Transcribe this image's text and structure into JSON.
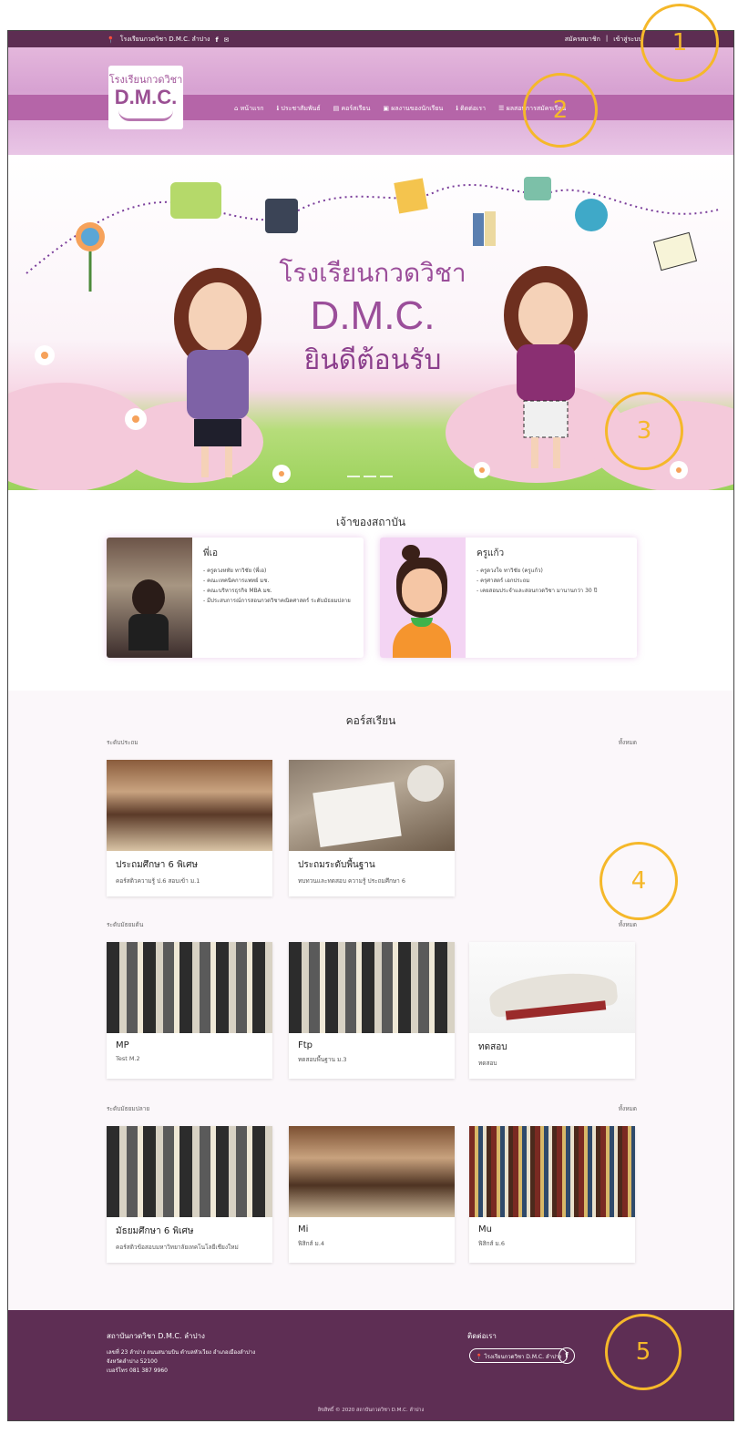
{
  "topbar": {
    "location": "โรงเรียนกวดวิชา D.M.C. ลำปาง",
    "register": "สมัครสมาชิก",
    "separator": "|",
    "login": "เข้าสู่ระบบ"
  },
  "logo": {
    "line1": "โรงเรียนกวดวิชา",
    "line2": "D.M.C."
  },
  "nav": {
    "items": [
      "หน้าแรก",
      "ประชาสัมพันธ์",
      "คอร์สเรียน",
      "ผลงานของนักเรียน",
      "ติดต่อเรา",
      "ผลสอบการสมัครเรียน"
    ]
  },
  "hero": {
    "line1": "โรงเรียนกวดวิชา",
    "line2": "D.M.C.",
    "line3": "ยินดีต้อนรับ"
  },
  "owners": {
    "title": "เจ้าของสถาบัน",
    "cards": [
      {
        "name": "พี่เอ",
        "points": [
          "- ครูดวงหทัย ทาวิชัย (พี่เอ)",
          "- คณะเทคนิคการแพทย์ มช.",
          "- คณะบริหารธุรกิจ MBA มช.",
          "- มีประสบการณ์การสอนกวดวิชาคณิตศาสตร์ ระดับมัธยมปลาย"
        ]
      },
      {
        "name": "ครูแก้ว",
        "points": [
          "- ครูดวงใจ ทาวิชัย (ครูแก้ว)",
          "- ครุศาสตร์ เอกประถม",
          "- เคยสอนประจำและสอนกวดวิชา มานานกว่า 30 ปี"
        ]
      }
    ]
  },
  "courses": {
    "title": "คอร์สเรียน",
    "see_all": "ทั้งหมด",
    "levels": [
      {
        "name": "ระดับประถม",
        "items": [
          {
            "title": "ประถมศึกษา 6 พิเศษ",
            "desc": "คอร์สติวความรู้ ป.6 สอบเข้า ม.1"
          },
          {
            "title": "ประถมระดับพื้นฐาน",
            "desc": "ทบทวนและทดสอบ ความรู้ ประถมศึกษา 6"
          }
        ]
      },
      {
        "name": "ระดับมัธยมต้น",
        "items": [
          {
            "title": "MP",
            "desc": "Test M.2"
          },
          {
            "title": "Ftp",
            "desc": "ทดสอบพื้นฐาน ม.3"
          },
          {
            "title": "ทดสอบ",
            "desc": "ทดสอบ"
          }
        ]
      },
      {
        "name": "ระดับมัธยมปลาย",
        "items": [
          {
            "title": "มัธยมศึกษา 6 พิเศษ",
            "desc": "คอร์สติวข้อสอบมหาวิทยาลัยเทคโนโลยีเชียงใหม่"
          },
          {
            "title": "Mi",
            "desc": "ฟิสิกส์ ม.4"
          },
          {
            "title": "Mu",
            "desc": "ฟิสิกส์ ม.6"
          }
        ]
      }
    ]
  },
  "footer": {
    "org": "สถาบันกวดวิชา D.M.C. ลำปาง",
    "address1": "เลขที่ 23 ลำปาง ถนนสนามบิน ตำบลหัวเวียง อำเภอเมืองลำปาง",
    "address2": "จังหวัดลำปาง 52100",
    "phone": "เบอร์โทร 081 387 9960",
    "contact_title": "ติดต่อเรา",
    "contact_pill": "โรงเรียนกวดวิชา D.M.C. ลำปาง",
    "fb": "f",
    "copyright": "ลิขสิทธิ์ © 2020 สถาบันกวดวิชา D.M.C. ลำปาง"
  },
  "annotations": [
    "1",
    "2",
    "3",
    "4",
    "5"
  ],
  "colors": {
    "accent": "#b565a8",
    "dark": "#5d2d52",
    "annotation": "#f5b82a"
  }
}
